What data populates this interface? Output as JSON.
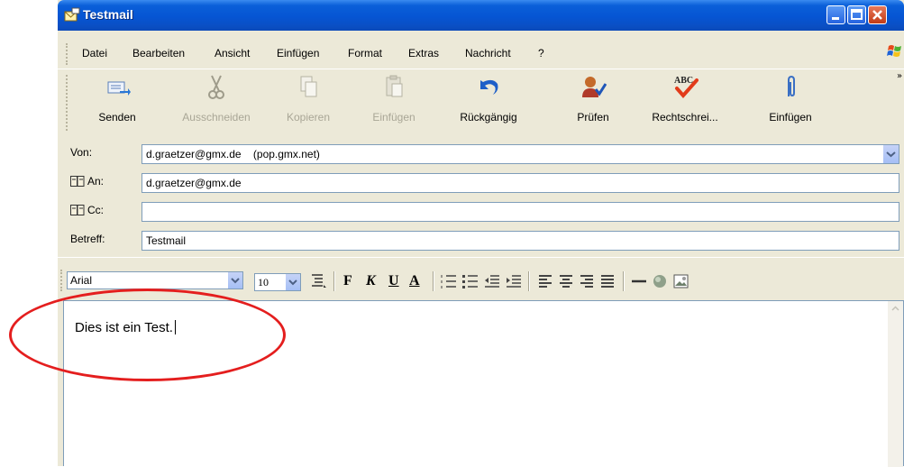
{
  "window": {
    "title": "Testmail"
  },
  "menu": {
    "items": [
      "Datei",
      "Bearbeiten",
      "Ansicht",
      "Einfügen",
      "Format",
      "Extras",
      "Nachricht",
      "?"
    ]
  },
  "toolbar": {
    "send": "Senden",
    "cut": "Ausschneiden",
    "copy": "Kopieren",
    "paste": "Einfügen",
    "undo": "Rückgängig",
    "check": "Prüfen",
    "spelling": "Rechtschrei...",
    "attach": "Einfügen",
    "spelling_icon_text": "ABC",
    "overflow": "»"
  },
  "headers": {
    "from_label": "Von:",
    "from_value": "d.graetzer@gmx.de    (pop.gmx.net)",
    "to_label": "An:",
    "to_value": "d.graetzer@gmx.de",
    "cc_label": "Cc:",
    "cc_value": "",
    "subject_label": "Betreff:",
    "subject_value": "Testmail"
  },
  "format": {
    "font": "Arial",
    "size": "10",
    "bold": "F",
    "italic": "K",
    "underline": "U",
    "color": "A"
  },
  "body": {
    "text": "Dies ist ein Test."
  },
  "colors": {
    "titlebar": "#0655d3",
    "chrome": "#ece9d8",
    "annotation": "#e41e1e"
  }
}
